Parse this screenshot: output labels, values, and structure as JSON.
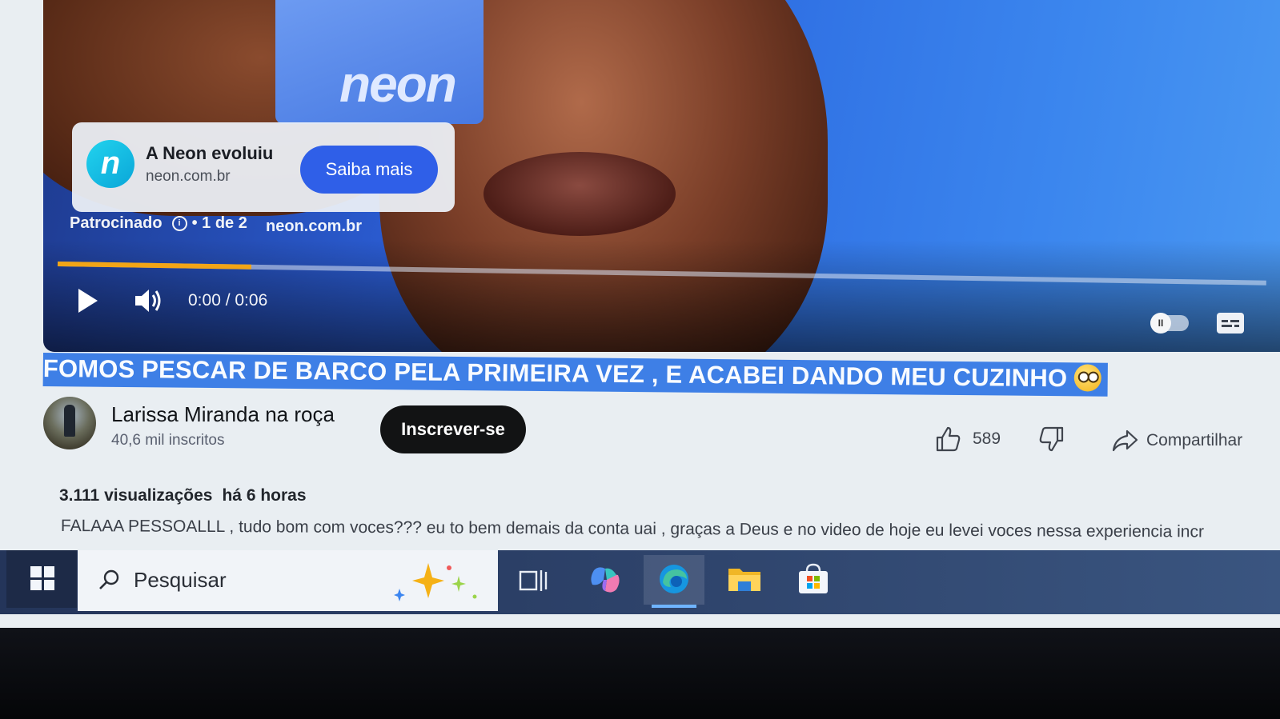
{
  "ad": {
    "card_logo": "neon",
    "logo_letter": "n",
    "title": "A Neon evoluiu",
    "url": "neon.com.br",
    "cta": "Saiba mais",
    "sponsored_label": "Patrocinado",
    "counter": "• 1 de 2",
    "link": "neon.com.br",
    "progress": 0.16
  },
  "player": {
    "time": "0:00 / 0:06",
    "autoplay_glyph": "II"
  },
  "video": {
    "title": "FOMOS PESCAR DE BARCO PELA PRIMEIRA VEZ , E ACABEI DANDO MEU CUZINHO",
    "title_emoji": "flushed-face",
    "views": "3.111 visualizações",
    "age": "há 6 horas",
    "description": "FALAAA PESSOALLL , tudo bom com voces??? eu to bem demais da conta uai , graças a Deus e no video de hoje eu levei voces nessa experiencia incr"
  },
  "channel": {
    "name": "Larissa Miranda na roça",
    "subscribers": "40,6 mil inscritos",
    "subscribe_label": "Inscrever-se"
  },
  "actions": {
    "likes": "589",
    "share_label": "Compartilhar"
  },
  "taskbar": {
    "search_label": "Pesquisar",
    "icons": [
      "windows-icon",
      "search-icon",
      "copilot-sparkle-icon",
      "task-view-icon",
      "copilot-icon",
      "edge-icon",
      "file-explorer-icon",
      "microsoft-store-icon"
    ]
  },
  "colors": {
    "accent_blue": "#2f5fe8",
    "selection": "#3e7fe6",
    "progress": "#f2a516",
    "taskbar": "#2b3f66"
  }
}
